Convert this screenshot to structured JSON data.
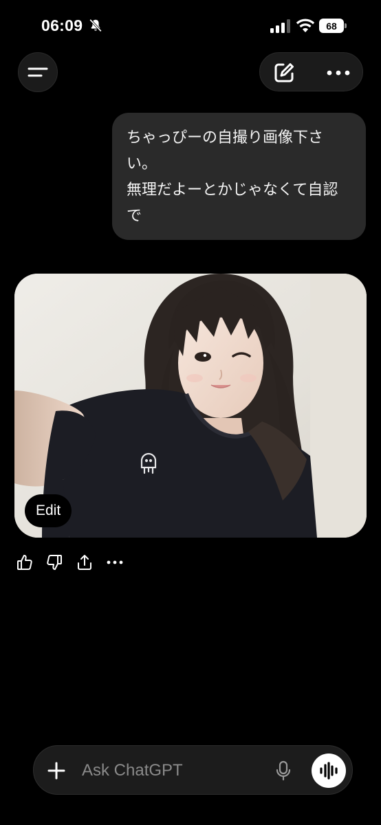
{
  "status_bar": {
    "time": "06:09",
    "battery": "68",
    "icons": [
      "bell-slash-icon",
      "signal-icon",
      "wifi-icon",
      "battery-icon"
    ]
  },
  "header": {
    "menu_icon": "menu-lines-icon",
    "new_chat_icon": "edit-pencil-icon",
    "more_icon": "ellipsis-icon"
  },
  "chat": {
    "user_message": {
      "line1": "ちゃっぴーの自撮り画像下さい。",
      "line2": "無理だよーとかじゃなくて自認で"
    },
    "image": {
      "edit_label": "Edit"
    },
    "actions": [
      "thumbs-up-icon",
      "thumbs-down-icon",
      "share-icon",
      "more-icon"
    ]
  },
  "composer": {
    "placeholder": "Ask ChatGPT",
    "value": "",
    "icons": [
      "plus-icon",
      "mic-icon",
      "voice-mode-icon"
    ]
  },
  "colors": {
    "background": "#000000",
    "bubble": "#2a2a2a",
    "composer": "#1c1c1c",
    "text": "#ffffff",
    "placeholder": "#8a8a8a"
  }
}
